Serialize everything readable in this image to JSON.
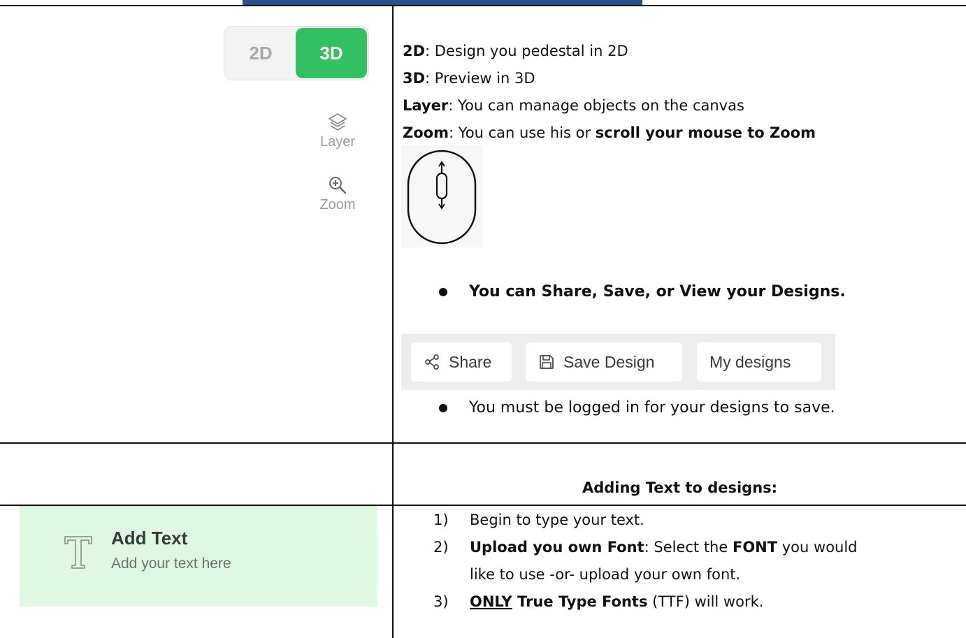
{
  "toggle": {
    "opt_2d": "2D",
    "opt_3d": "3D",
    "active_color": "#33c061"
  },
  "tools": {
    "layer_label": "Layer",
    "zoom_label": "Zoom"
  },
  "intro": [
    {
      "term": "2D",
      "text": ": Design you pedestal in 2D"
    },
    {
      "term": "3D",
      "text": ": Preview in 3D"
    },
    {
      "term": "Layer",
      "text": ": You can manage objects on the canvas"
    },
    {
      "term": "Zoom",
      "text": ":  You can use his or ",
      "bold_tail": "scroll your mouse to Zoom"
    }
  ],
  "bullets": {
    "share_save_view": "You can Share, Save, or View your Designs.",
    "logged_in": "You must be logged in for your designs to save."
  },
  "buttons": {
    "share": "Share",
    "save_design": "Save Design",
    "my_designs": "My designs"
  },
  "section_heading": "Adding Text to designs:",
  "add_text_card": {
    "title": "Add Text",
    "subtitle": "Add your text here",
    "bg": "#dff8e2"
  },
  "steps": [
    {
      "num": "1)",
      "text": "Begin to type your text."
    },
    {
      "num": "2)",
      "bold1": "Upload you own Font",
      "text1": ": Select the ",
      "bold2": "FONT",
      "text2": " you would",
      "line2": "like to use -or- upload your own font."
    },
    {
      "num": "3)",
      "underline": "ONLY",
      "bold": " True Type Fonts",
      "text": " (TTF) will work."
    }
  ]
}
